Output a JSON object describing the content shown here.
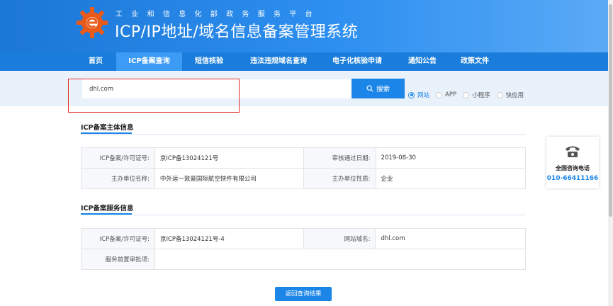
{
  "header": {
    "subtitle": "工业和信息化部政务服务平台",
    "title": "ICP/IP地址/域名信息备案管理系统"
  },
  "nav": {
    "items": [
      {
        "label": "首页",
        "active": false
      },
      {
        "label": "ICP备案查询",
        "active": true
      },
      {
        "label": "短信核验",
        "active": false
      },
      {
        "label": "违法违规域名查询",
        "active": false
      },
      {
        "label": "电子化核验申请",
        "active": false
      },
      {
        "label": "通知公告",
        "active": false
      },
      {
        "label": "政策文件",
        "active": false
      }
    ]
  },
  "search": {
    "value": "dhl.com",
    "button_label": "搜索",
    "options": [
      {
        "label": "网站",
        "selected": true
      },
      {
        "label": "APP",
        "selected": false
      },
      {
        "label": "小程序",
        "selected": false
      },
      {
        "label": "快应用",
        "selected": false
      }
    ]
  },
  "entity": {
    "title": "ICP备案主体信息",
    "rows": [
      {
        "label1": "ICP备案/许可证号:",
        "value1": "京ICP备13024121号",
        "label2": "审核通过日期:",
        "value2": "2019-08-30"
      },
      {
        "label1": "主办单位名称:",
        "value1": "中外运一敦豪国际航空快件有限公司",
        "label2": "主办单位性质:",
        "value2": "企业"
      }
    ]
  },
  "service": {
    "title": "ICP备案服务信息",
    "rows": [
      {
        "label1": "ICP备案/许可证号:",
        "value1": "京ICP备13024121号-4",
        "label2": "网站域名:",
        "value2": "dhl.com"
      },
      {
        "label1": "服务前置审批项:",
        "value1": ""
      }
    ]
  },
  "back_button": "返回查询结果",
  "contact": {
    "label": "全国咨询电话",
    "phone": "010-66411166"
  },
  "colors": {
    "primary": "#1c86e8",
    "nav": "#1a7ddb",
    "highlight_box": "#e62e2e"
  }
}
